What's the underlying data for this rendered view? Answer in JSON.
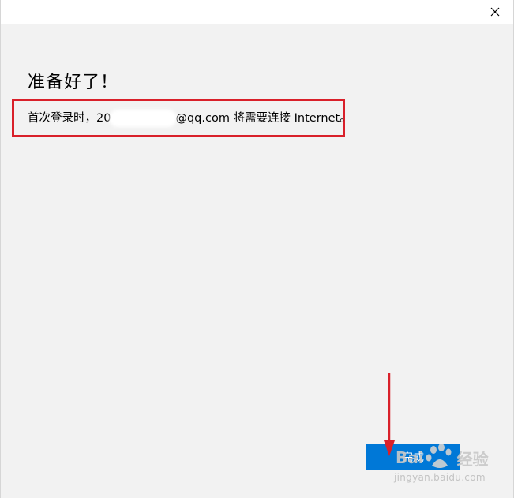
{
  "window": {
    "close_glyph": "✕"
  },
  "content": {
    "heading": "准备好了！",
    "message_prefix": "首次登录时，20",
    "message_suffix": "@qq.com 将需要连接 Internet。"
  },
  "actions": {
    "done_label": "完成"
  },
  "watermark": {
    "brand": "Bai",
    "brand_cn": "经验",
    "url": "jingyan.baidu.com"
  },
  "colors": {
    "accent": "#0078d7",
    "highlight": "#d9202a",
    "background": "#f2f2f2"
  }
}
